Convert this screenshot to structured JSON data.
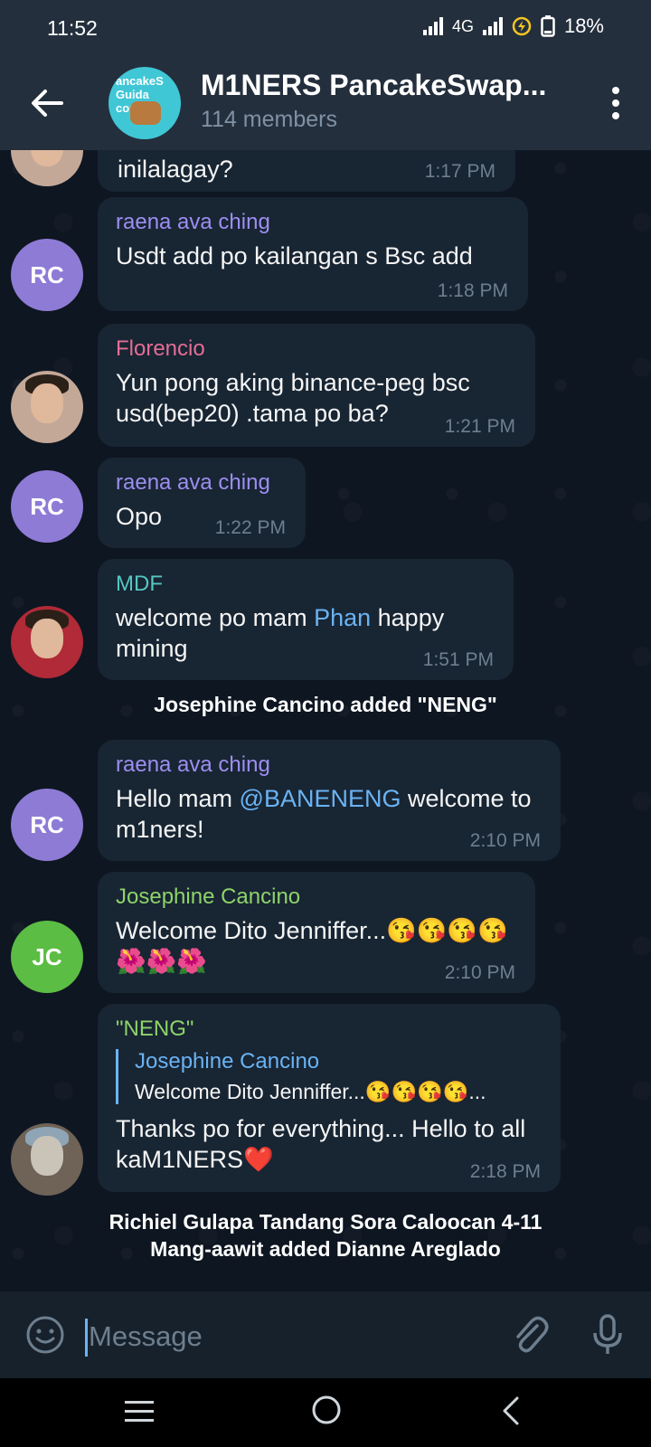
{
  "status_bar": {
    "time": "11:52",
    "network": "4G",
    "battery": "18%"
  },
  "header": {
    "title": "M1NERS PancakeSwap...",
    "subtitle": "114 members",
    "avatar_text": "ancakeS Guida comple"
  },
  "messages": [
    {
      "type": "text",
      "text": "inilalagay?",
      "time": "1:17 PM"
    },
    {
      "sender": "raena ava ching",
      "sender_color": "#9d8ef1",
      "avatar": "RC",
      "avatar_color": "#8e7bd6",
      "text": "Usdt add po kailangan s Bsc add",
      "time": "1:18 PM"
    },
    {
      "sender": "Florencio",
      "sender_color": "#e46e95",
      "text": "Yun pong aking binance-peg bsc usd(bep20) .tama po ba?",
      "time": "1:21 PM"
    },
    {
      "sender": "raena ava ching",
      "sender_color": "#9d8ef1",
      "avatar": "RC",
      "avatar_color": "#8e7bd6",
      "text": "Opo",
      "time": "1:22 PM"
    },
    {
      "sender": "MDF",
      "sender_color": "#54c7c1",
      "text_before": "welcome po mam ",
      "mention": "Phan",
      "text_after": " happy mining",
      "time": "1:51 PM"
    },
    {
      "sender": "raena ava ching",
      "sender_color": "#9d8ef1",
      "avatar": "RC",
      "avatar_color": "#8e7bd6",
      "text_before": "Hello mam ",
      "mention": "@BANENENG",
      "text_after": " welcome to m1ners!",
      "time": "2:10 PM"
    },
    {
      "sender": "Josephine Cancino",
      "sender_color": "#8ed36a",
      "avatar": "JC",
      "avatar_color": "#5bbd43",
      "text": "Welcome Dito Jenniffer...😘😘😘😘🌺🌺🌺",
      "time": "2:10 PM"
    },
    {
      "sender": "\"NENG\"",
      "sender_color": "#8ed36a",
      "reply_name": "Josephine Cancino",
      "reply_text": "Welcome Dito Jenniffer...😘😘😘😘...",
      "text": "Thanks po for everything... Hello to all kaM1NERS❤️",
      "time": "2:18 PM"
    }
  ],
  "service_messages": [
    "Josephine Cancino added \"NENG\"",
    "Richiel Gulapa Tandang Sora Caloocan 4-11",
    "Mang-aawit added Dianne Areglado"
  ],
  "composer": {
    "placeholder": "Message"
  },
  "icons": [
    "back-arrow-icon",
    "more-vert-icon",
    "emoji-icon",
    "attach-icon",
    "mic-icon",
    "nav-menu-icon",
    "nav-home-icon",
    "nav-back-icon"
  ]
}
